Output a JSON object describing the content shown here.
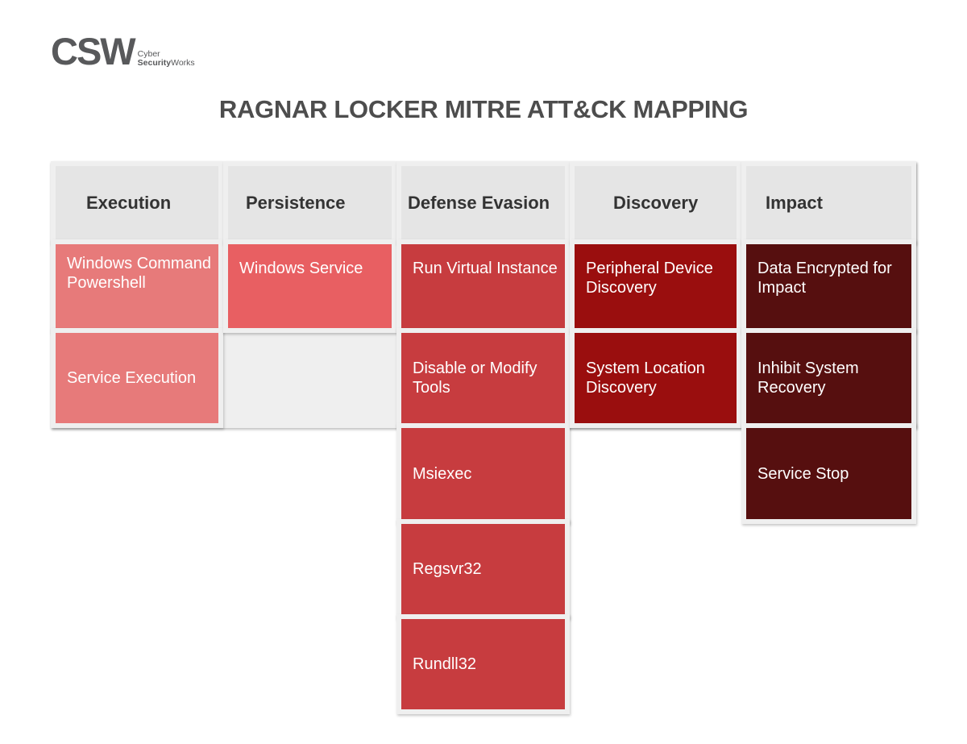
{
  "logo": {
    "mark": "CSW",
    "line1": "Cyber",
    "line2_bold": "Security",
    "line2_rest": "Works"
  },
  "title": "RAGNAR LOCKER MITRE ATT&CK MAPPING",
  "colors": {
    "header_bg": "#e5e5e5",
    "execution": "#e77a7a",
    "persistence": "#e85f62",
    "defense_evasion": "#c73c3f",
    "discovery": "#9a0e0e",
    "impact": "#560f0f"
  },
  "tactics": [
    {
      "name": "Execution",
      "techniques": [
        "Windows Command Powershell",
        "Service Execution"
      ]
    },
    {
      "name": "Persistence",
      "techniques": [
        "Windows Service"
      ]
    },
    {
      "name": "Defense Evasion",
      "techniques": [
        "Run Virtual Instance",
        "Disable or Modify Tools",
        "Msiexec",
        "Regsvr32",
        "Rundll32"
      ]
    },
    {
      "name": "Discovery",
      "techniques": [
        "Peripheral Device Discovery",
        "System Location Discovery"
      ]
    },
    {
      "name": "Impact",
      "techniques": [
        "Data Encrypted for Impact",
        "Inhibit System Recovery",
        "Service Stop"
      ]
    }
  ]
}
